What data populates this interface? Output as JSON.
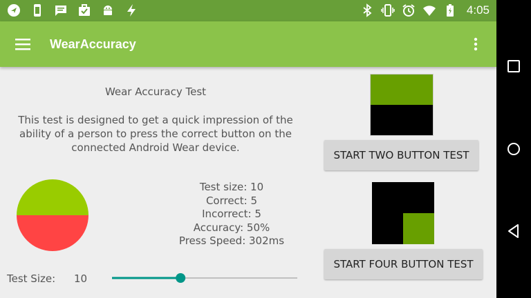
{
  "status_bar": {
    "time": "4:05",
    "left_icons": [
      "navigation-icon",
      "watch-icon",
      "message-icon",
      "briefcase-icon",
      "android-icon",
      "flash-icon"
    ],
    "right_icons": [
      "bluetooth-icon",
      "vibrate-icon",
      "alarm-icon",
      "wifi-icon",
      "battery-icon"
    ]
  },
  "app_bar": {
    "title": "WearAccuracy"
  },
  "main": {
    "test_title": "Wear Accuracy Test",
    "description": "This test is designed to get a quick impression of the ability of a person to press the correct button on the connected Android Wear device.",
    "stats": {
      "test_size": "Test size: 10",
      "correct": "Correct: 5",
      "incorrect": "Incorrect: 5",
      "accuracy": "Accuracy: 50%",
      "press_speed": "Press Speed: 302ms"
    },
    "pie": {
      "correct_fraction": 0.5,
      "correct_color": "#99cc00",
      "incorrect_color": "#ff4444"
    },
    "slider": {
      "label": "Test Size:",
      "value": "10",
      "fraction": 0.37,
      "accent": "#009688"
    },
    "buttons": {
      "two": "START TWO BUTTON TEST",
      "four": "START FOUR BUTTON TEST"
    }
  },
  "colors": {
    "status_bar": "#689f38",
    "app_bar": "#8bc34a",
    "preview_green": "#689f00"
  }
}
